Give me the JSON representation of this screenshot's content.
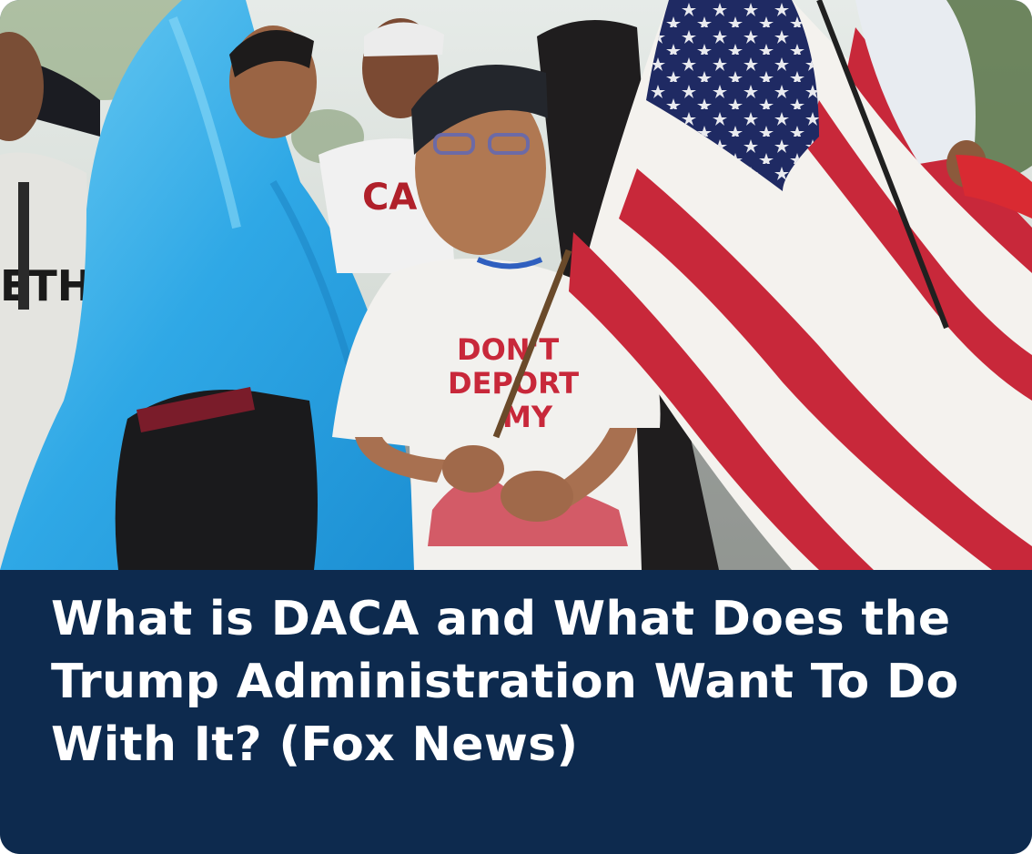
{
  "card": {
    "headline": "What is DACA and What Does the Trump Administration Want To Do With It? (Fox News)",
    "photo": {
      "shirt_text": [
        "DON'T",
        "DEPORT",
        "MY"
      ]
    },
    "colors": {
      "caption_background": "#0d2a4e",
      "headline_text": "#ffffff",
      "flag_red": "#c8283a",
      "flag_blue": "#1f2a63",
      "poncho_blue": "#3fb2ea"
    }
  }
}
